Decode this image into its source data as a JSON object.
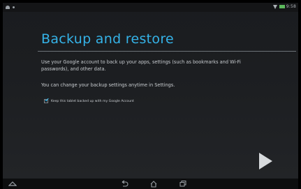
{
  "status_bar": {
    "left_icons": [
      "android-icon",
      "notification-dot-icon"
    ],
    "right_icons": [
      "wifi-icon",
      "battery-icon"
    ],
    "clock": "9:58"
  },
  "page": {
    "title": "Backup and restore",
    "description": "Use your Google account to back up your apps, settings (such as bookmarks and Wi-Fi passwords), and other data.",
    "note": "You can change your backup settings anytime in Settings.",
    "checkbox": {
      "label": "Keep this tablet backed up with my Google Account",
      "checked": true
    }
  },
  "navigation": {
    "next_icon": "play-arrow-icon",
    "nav_icons": [
      "asus-hat-icon",
      "back-icon",
      "home-icon",
      "recents-icon"
    ]
  },
  "colors": {
    "accent": "#35b3e8",
    "background": "#1c1e21",
    "text": "#c9cdd1"
  }
}
